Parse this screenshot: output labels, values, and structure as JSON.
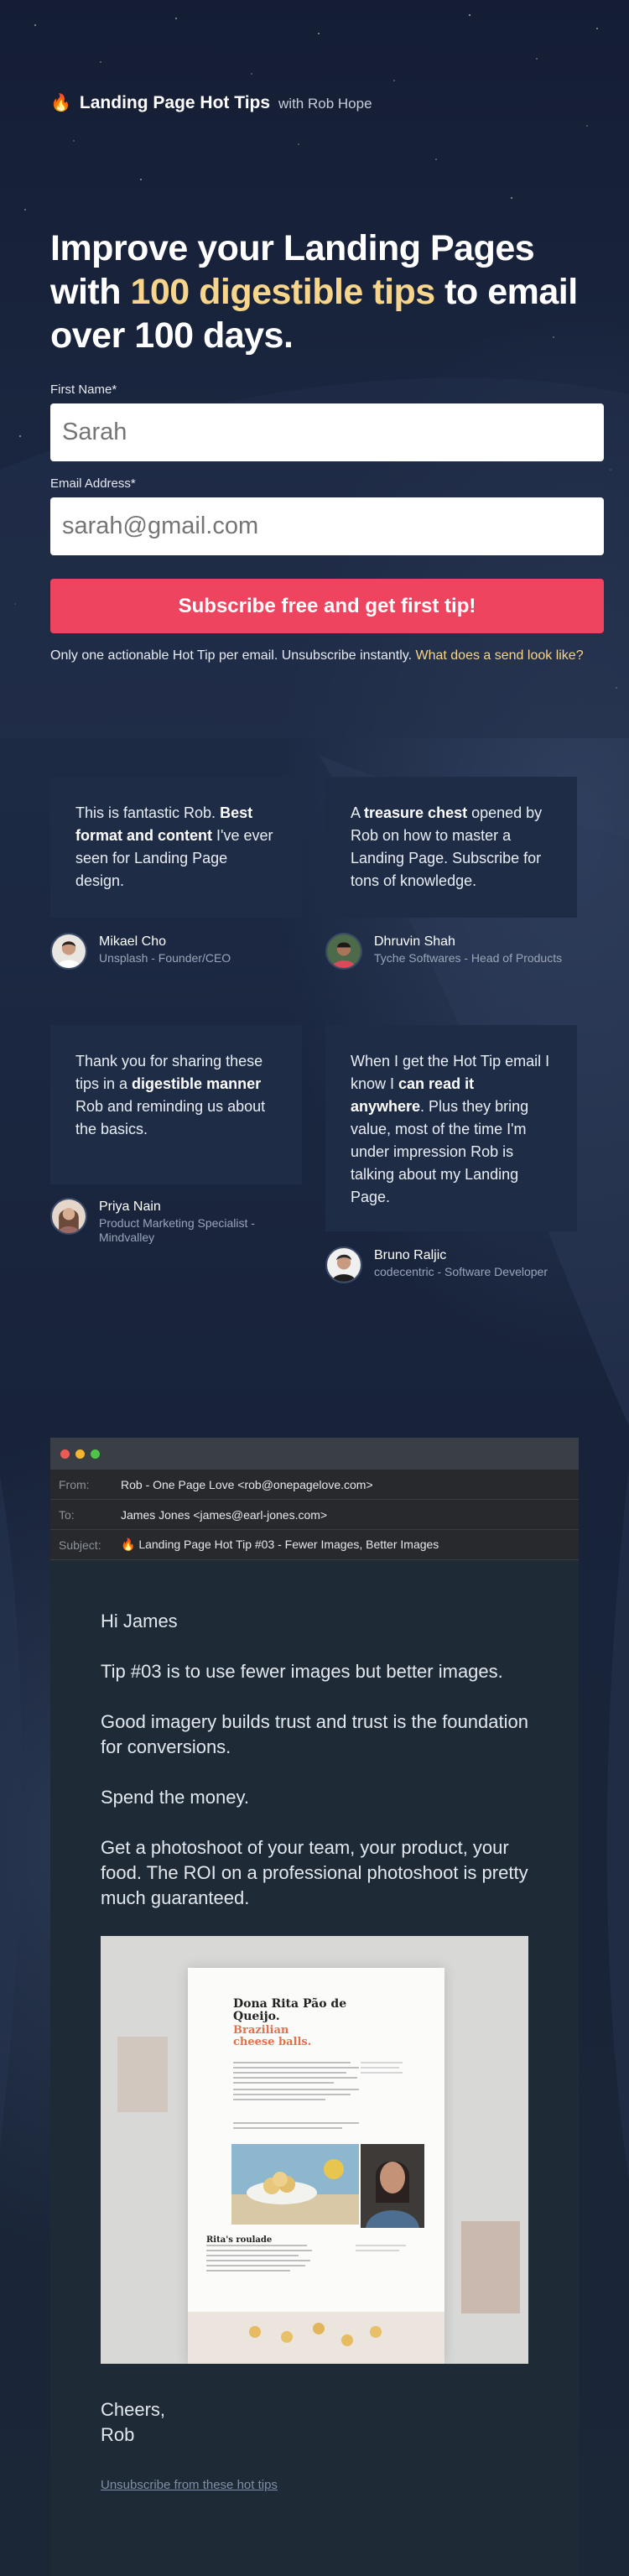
{
  "brand": {
    "title": "Landing Page Hot Tips",
    "subtitle": "with Rob Hope",
    "icon": "fire-icon"
  },
  "headline": {
    "part1": "Improve your Landing Pages with ",
    "highlight": "100 digestible tips",
    "part2": " to email over 100 days."
  },
  "form": {
    "first_name_label": "First Name*",
    "first_name_placeholder": "Sarah",
    "email_label": "Email Address*",
    "email_placeholder": "sarah@gmail.com",
    "submit_label": "Subscribe free and get first tip!",
    "fine_print": "Only one actionable Hot Tip per email. Unsubscribe instantly. ",
    "fine_link": "What does a send look like?"
  },
  "testimonials": [
    {
      "pre": "This is fantastic Rob. ",
      "bold": "Best format and content",
      "post": " I've ever seen for Landing Page design.",
      "name": "Mikael Cho",
      "role": "Unsplash - Founder/CEO"
    },
    {
      "pre": "A ",
      "bold": "treasure chest",
      "post": " opened by Rob on how to master a Landing Page. Subscribe for tons of knowledge.",
      "name": "Dhruvin Shah",
      "role": "Tyche Softwares - Head of Products"
    },
    {
      "pre": "Thank you for sharing these tips in a ",
      "bold": "digestible manner",
      "post": " Rob and reminding us about the basics.",
      "name": "Priya Nain",
      "role": "Product Marketing Specialist - Mindvalley"
    },
    {
      "pre": "When I get the Hot Tip email I know I ",
      "bold": "can read it anywhere",
      "post": ". Plus they bring value, most of the time I'm under impression Rob is talking about my Landing Page.",
      "name": "Bruno Raljic",
      "role": "codecentric - Software Developer"
    }
  ],
  "email": {
    "from_label": "From:",
    "from": "Rob - One Page Love <rob@onepagelove.com>",
    "to_label": "To:",
    "to": "James Jones <james@earl-jones.com>",
    "subject_label": "Subject:",
    "subject": "Landing Page Hot Tip #03 - Fewer Images, Better Images",
    "greeting": "Hi James",
    "p1": "Tip #03 is to use fewer images but better images.",
    "p2": "Good imagery builds trust and trust is the foundation for conversions.",
    "p3": "Spend the money.",
    "p4": "Get a photoshoot of your team, your product, your food. The ROI on a professional photoshoot is pretty much guaranteed.",
    "image": {
      "title": "Dona Rita Pão de Queijo.",
      "subtitle": "Brazilian cheese balls.",
      "section_heading": "Rita's roulade"
    },
    "signoff": "Cheers,",
    "signature": "Rob",
    "unsubscribe": "Unsubscribe from these hot tips"
  },
  "colors": {
    "accent": "#ef4460",
    "highlight": "#f7d58b",
    "card": "#1f2c46"
  }
}
